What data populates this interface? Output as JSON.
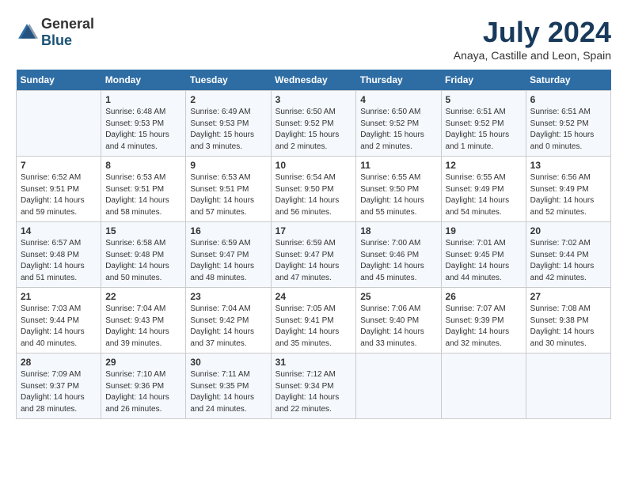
{
  "header": {
    "logo_general": "General",
    "logo_blue": "Blue",
    "title": "July 2024",
    "subtitle": "Anaya, Castille and Leon, Spain"
  },
  "days_of_week": [
    "Sunday",
    "Monday",
    "Tuesday",
    "Wednesday",
    "Thursday",
    "Friday",
    "Saturday"
  ],
  "weeks": [
    [
      {
        "day": "",
        "info": ""
      },
      {
        "day": "1",
        "info": "Sunrise: 6:48 AM\nSunset: 9:53 PM\nDaylight: 15 hours\nand 4 minutes."
      },
      {
        "day": "2",
        "info": "Sunrise: 6:49 AM\nSunset: 9:53 PM\nDaylight: 15 hours\nand 3 minutes."
      },
      {
        "day": "3",
        "info": "Sunrise: 6:50 AM\nSunset: 9:52 PM\nDaylight: 15 hours\nand 2 minutes."
      },
      {
        "day": "4",
        "info": "Sunrise: 6:50 AM\nSunset: 9:52 PM\nDaylight: 15 hours\nand 2 minutes."
      },
      {
        "day": "5",
        "info": "Sunrise: 6:51 AM\nSunset: 9:52 PM\nDaylight: 15 hours\nand 1 minute."
      },
      {
        "day": "6",
        "info": "Sunrise: 6:51 AM\nSunset: 9:52 PM\nDaylight: 15 hours\nand 0 minutes."
      }
    ],
    [
      {
        "day": "7",
        "info": "Sunrise: 6:52 AM\nSunset: 9:51 PM\nDaylight: 14 hours\nand 59 minutes."
      },
      {
        "day": "8",
        "info": "Sunrise: 6:53 AM\nSunset: 9:51 PM\nDaylight: 14 hours\nand 58 minutes."
      },
      {
        "day": "9",
        "info": "Sunrise: 6:53 AM\nSunset: 9:51 PM\nDaylight: 14 hours\nand 57 minutes."
      },
      {
        "day": "10",
        "info": "Sunrise: 6:54 AM\nSunset: 9:50 PM\nDaylight: 14 hours\nand 56 minutes."
      },
      {
        "day": "11",
        "info": "Sunrise: 6:55 AM\nSunset: 9:50 PM\nDaylight: 14 hours\nand 55 minutes."
      },
      {
        "day": "12",
        "info": "Sunrise: 6:55 AM\nSunset: 9:49 PM\nDaylight: 14 hours\nand 54 minutes."
      },
      {
        "day": "13",
        "info": "Sunrise: 6:56 AM\nSunset: 9:49 PM\nDaylight: 14 hours\nand 52 minutes."
      }
    ],
    [
      {
        "day": "14",
        "info": "Sunrise: 6:57 AM\nSunset: 9:48 PM\nDaylight: 14 hours\nand 51 minutes."
      },
      {
        "day": "15",
        "info": "Sunrise: 6:58 AM\nSunset: 9:48 PM\nDaylight: 14 hours\nand 50 minutes."
      },
      {
        "day": "16",
        "info": "Sunrise: 6:59 AM\nSunset: 9:47 PM\nDaylight: 14 hours\nand 48 minutes."
      },
      {
        "day": "17",
        "info": "Sunrise: 6:59 AM\nSunset: 9:47 PM\nDaylight: 14 hours\nand 47 minutes."
      },
      {
        "day": "18",
        "info": "Sunrise: 7:00 AM\nSunset: 9:46 PM\nDaylight: 14 hours\nand 45 minutes."
      },
      {
        "day": "19",
        "info": "Sunrise: 7:01 AM\nSunset: 9:45 PM\nDaylight: 14 hours\nand 44 minutes."
      },
      {
        "day": "20",
        "info": "Sunrise: 7:02 AM\nSunset: 9:44 PM\nDaylight: 14 hours\nand 42 minutes."
      }
    ],
    [
      {
        "day": "21",
        "info": "Sunrise: 7:03 AM\nSunset: 9:44 PM\nDaylight: 14 hours\nand 40 minutes."
      },
      {
        "day": "22",
        "info": "Sunrise: 7:04 AM\nSunset: 9:43 PM\nDaylight: 14 hours\nand 39 minutes."
      },
      {
        "day": "23",
        "info": "Sunrise: 7:04 AM\nSunset: 9:42 PM\nDaylight: 14 hours\nand 37 minutes."
      },
      {
        "day": "24",
        "info": "Sunrise: 7:05 AM\nSunset: 9:41 PM\nDaylight: 14 hours\nand 35 minutes."
      },
      {
        "day": "25",
        "info": "Sunrise: 7:06 AM\nSunset: 9:40 PM\nDaylight: 14 hours\nand 33 minutes."
      },
      {
        "day": "26",
        "info": "Sunrise: 7:07 AM\nSunset: 9:39 PM\nDaylight: 14 hours\nand 32 minutes."
      },
      {
        "day": "27",
        "info": "Sunrise: 7:08 AM\nSunset: 9:38 PM\nDaylight: 14 hours\nand 30 minutes."
      }
    ],
    [
      {
        "day": "28",
        "info": "Sunrise: 7:09 AM\nSunset: 9:37 PM\nDaylight: 14 hours\nand 28 minutes."
      },
      {
        "day": "29",
        "info": "Sunrise: 7:10 AM\nSunset: 9:36 PM\nDaylight: 14 hours\nand 26 minutes."
      },
      {
        "day": "30",
        "info": "Sunrise: 7:11 AM\nSunset: 9:35 PM\nDaylight: 14 hours\nand 24 minutes."
      },
      {
        "day": "31",
        "info": "Sunrise: 7:12 AM\nSunset: 9:34 PM\nDaylight: 14 hours\nand 22 minutes."
      },
      {
        "day": "",
        "info": ""
      },
      {
        "day": "",
        "info": ""
      },
      {
        "day": "",
        "info": ""
      }
    ]
  ]
}
